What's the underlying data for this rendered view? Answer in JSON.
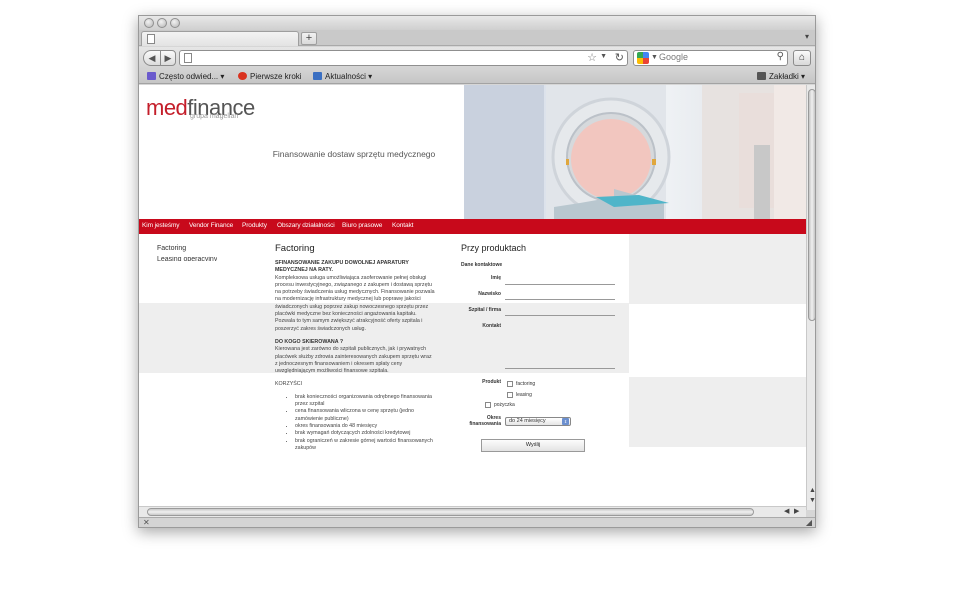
{
  "browser": {
    "tab_title": "",
    "new_tab_label": "+",
    "tab_menu_label": "▾",
    "back_label": "◀",
    "forward_label": "▶",
    "url": "",
    "search_placeholder": "Google",
    "home_label": "⌂",
    "bookmarks": [
      {
        "label": "Często odwied...",
        "icon": "most-visited-icon",
        "has_dropdown": true,
        "color": "#6a5acd"
      },
      {
        "label": "Pierwsze kroki",
        "icon": "firefox-start-icon",
        "has_dropdown": false,
        "color": "#d9321f"
      },
      {
        "label": "Aktualności",
        "icon": "rss-feed-icon",
        "has_dropdown": true,
        "color": "#3a6fc2"
      }
    ],
    "bookmarks_menu_label": "Zakładki",
    "status_icon": "resize-icon"
  },
  "site": {
    "logo_med": "med",
    "logo_finance": "finance",
    "logo_sub": "grupa magellan",
    "tagline": "Finansowanie dostaw sprzętu medycznego",
    "hero_image": "ct-scanner-photo",
    "brand_red": "#c8091b",
    "menu": [
      "Kim jesteśmy",
      "Vendor Finance",
      "Produkty",
      "Obszary działalności",
      "Biuro prasowe",
      "Kontakt"
    ],
    "submenu": [
      "Factoring",
      "Leasing operacyjny"
    ],
    "content": {
      "title": "Factoring",
      "subtitle": "SFINANSOWANIE ZAKUPU DOWOLNEJ APARATURY MEDYCZNEJ NA RATY.",
      "para1": "Kompleksowa usługa umożliwiająca zaoferowanie pełnej obsługi procesu inwestycyjnego, związanego z zakupem i dostawą sprzętu na potrzeby świadczenia usług medycznych. Finansowanie pozwala na modernizację infrastruktury medycznej lub poprawę jakości świadczonych usług poprzez zakup nowoczesnego sprzętu przez placówki medyczne bez konieczności angażowania kapitału.",
      "para2": "Pozwala to tym samym zwiększyć atrakcyjność oferty szpitala i poszerzyć zakres świadczonych usług.",
      "heading2": "DO KOGO SKIEROWANA ?",
      "para3": "Kierowana jest zarówno do szpitali publicznych, jak i prywatnych placówek służby zdrowia zainteresowanych zakupem sprzętu wraz z jednoczesnym finansowaniem i okresem spłaty ceny uwzględniającym możliwości finansowe szpitala.",
      "heading3": "KORZYŚCI",
      "benefits": [
        "brak konieczności organizowania odrębnego finansowania przez szpital",
        "cena finansowania wliczona w cenę sprzętu (jedno zamówienie publiczne)",
        "okres finansowania do 48 miesięcy",
        "brak wymagań dotyczących zdolności kredytowej",
        "brak ograniczeń w zakresie górnej wartości finansowanych zakupów"
      ]
    },
    "form": {
      "title": "Przy produktach",
      "section": "Dane kontaktowe",
      "name_label": "Imię",
      "surname_label": "Nazwisko",
      "company_label": "Szpital / firma",
      "contact_label": "Kontakt",
      "product_label": "Produkt",
      "options": [
        "factoring",
        "leasing",
        "pożyczka"
      ],
      "period_label": "Okres finansowania",
      "period_value": "do 24 miesięcy",
      "submit_label": "Wyślij"
    }
  }
}
